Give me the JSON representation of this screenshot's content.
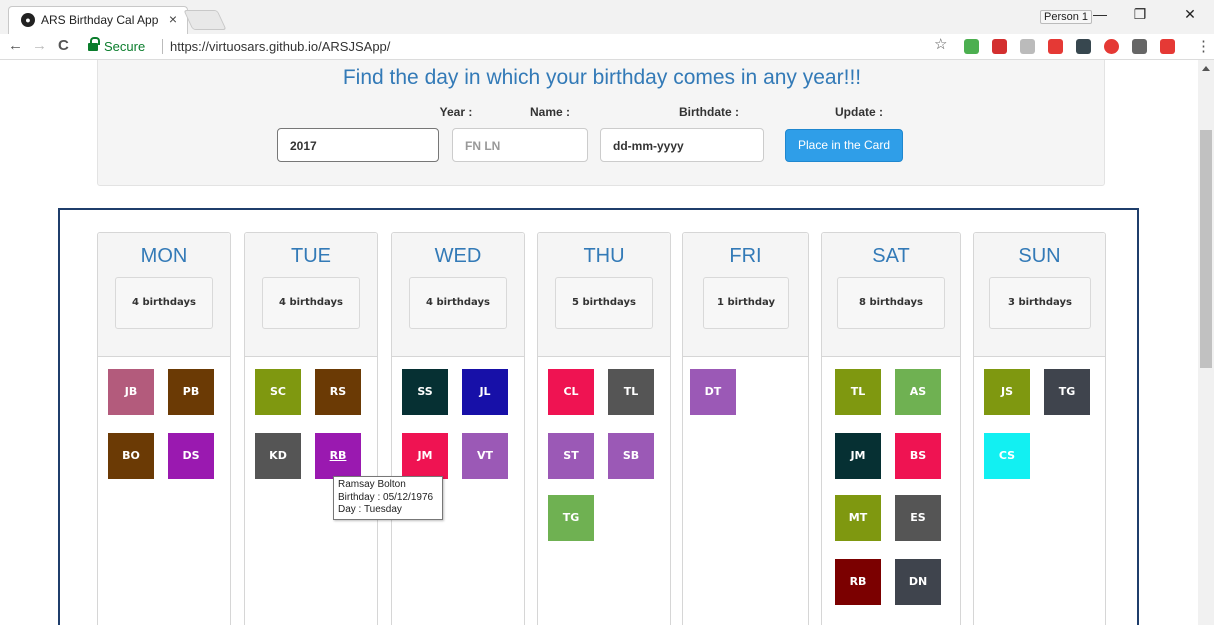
{
  "browser": {
    "tab_title": "ARS Birthday Cal App",
    "tab_close": "×",
    "profile": "Person 1",
    "minimize": "—",
    "restore": "❐",
    "close": "✕",
    "back": "←",
    "forward": "→",
    "reload": "C",
    "secure_label": "Secure",
    "url": "https://virtuosars.github.io/ARSJSApp/",
    "star": "☆",
    "menu": "⋮"
  },
  "form": {
    "headline": "Find the day in which your birthday comes in any year!!!",
    "year_label": "Year :",
    "name_label": "Name :",
    "birthdate_label": "Birthdate :",
    "update_label": "Update :",
    "year_value": "2017",
    "name_placeholder": "FN LN",
    "birthdate_placeholder": "dd-mm-yyyy",
    "button_label": "Place in the Card"
  },
  "days": [
    {
      "name": "MON",
      "count": "4 birthdays",
      "people": [
        {
          "initials": "JB",
          "color": "#b35b7c"
        },
        {
          "initials": "PB",
          "color": "#6b3a05"
        },
        {
          "initials": "BO",
          "color": "#6b3a05"
        },
        {
          "initials": "DS",
          "color": "#9a19b0"
        }
      ]
    },
    {
      "name": "TUE",
      "count": "4 birthdays",
      "people": [
        {
          "initials": "SC",
          "color": "#7f9810"
        },
        {
          "initials": "RS",
          "color": "#6b3a05"
        },
        {
          "initials": "KD",
          "color": "#555555"
        },
        {
          "initials": "RB",
          "color": "#9a19b0"
        }
      ]
    },
    {
      "name": "WED",
      "count": "4 birthdays",
      "people": [
        {
          "initials": "SS",
          "color": "#063033"
        },
        {
          "initials": "JL",
          "color": "#1710a8"
        },
        {
          "initials": "JM",
          "color": "#ef1352"
        },
        {
          "initials": "VT",
          "color": "#9b59b6"
        }
      ]
    },
    {
      "name": "THU",
      "count": "5 birthdays",
      "people": [
        {
          "initials": "CL",
          "color": "#ef1352"
        },
        {
          "initials": "TL",
          "color": "#555555"
        },
        {
          "initials": "ST",
          "color": "#9b59b6"
        },
        {
          "initials": "SB",
          "color": "#9b59b6"
        },
        {
          "initials": "TG",
          "color": "#6fb152"
        }
      ]
    },
    {
      "name": "FRI",
      "count": "1 birthday",
      "people": [
        {
          "initials": "DT",
          "color": "#9b59b6"
        }
      ]
    },
    {
      "name": "SAT",
      "count": "8 birthdays",
      "people": [
        {
          "initials": "TL",
          "color": "#7f9810"
        },
        {
          "initials": "AS",
          "color": "#6fb152"
        },
        {
          "initials": "JM",
          "color": "#063033"
        },
        {
          "initials": "BS",
          "color": "#ef1352"
        },
        {
          "initials": "MT",
          "color": "#7f9810"
        },
        {
          "initials": "ES",
          "color": "#555555"
        },
        {
          "initials": "RB",
          "color": "#7b0000"
        },
        {
          "initials": "DN",
          "color": "#3f444d"
        }
      ]
    },
    {
      "name": "SUN",
      "count": "3 birthdays",
      "people": [
        {
          "initials": "JS",
          "color": "#7f9810"
        },
        {
          "initials": "TG",
          "color": "#3f444d"
        },
        {
          "initials": "CS",
          "color": "#12f0f2"
        }
      ]
    }
  ],
  "tooltip": {
    "line1": "Ramsay Bolton",
    "line2": "Birthday : 05/12/1976",
    "line3": "Day : Tuesday"
  }
}
